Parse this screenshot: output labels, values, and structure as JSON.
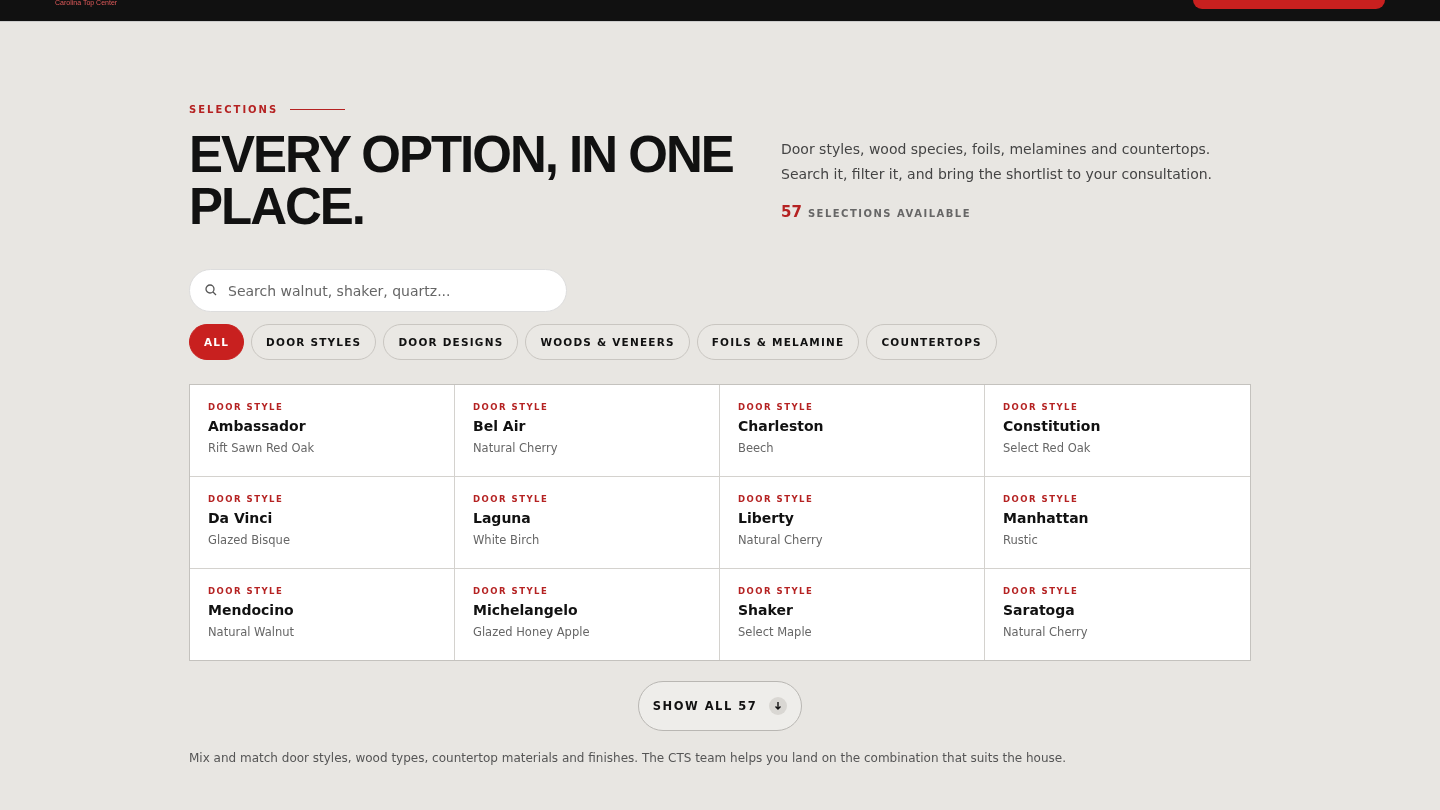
{
  "top_bar": {
    "logo_text": "Carolina Top Center"
  },
  "eyebrow": "SELECTIONS",
  "heading": "EVERY OPTION, IN ONE PLACE.",
  "intro": "Door styles, wood species, foils, melamines and countertops. Search it, filter it, and bring the shortlist to your consultation.",
  "count": {
    "number": "57",
    "label": "SELECTIONS AVAILABLE"
  },
  "search": {
    "placeholder": "Search walnut, shaker, quartz..."
  },
  "filters": [
    {
      "label": "ALL",
      "selected": true
    },
    {
      "label": "DOOR STYLES",
      "selected": false
    },
    {
      "label": "DOOR DESIGNS",
      "selected": false
    },
    {
      "label": "WOODS & VENEERS",
      "selected": false
    },
    {
      "label": "FOILS & MELAMINE",
      "selected": false
    },
    {
      "label": "COUNTERTOPS",
      "selected": false
    }
  ],
  "cards": [
    {
      "category": "DOOR STYLE",
      "name": "Ambassador",
      "finish": "Rift Sawn Red Oak"
    },
    {
      "category": "DOOR STYLE",
      "name": "Bel Air",
      "finish": "Natural Cherry"
    },
    {
      "category": "DOOR STYLE",
      "name": "Charleston",
      "finish": "Beech"
    },
    {
      "category": "DOOR STYLE",
      "name": "Constitution",
      "finish": "Select Red Oak"
    },
    {
      "category": "DOOR STYLE",
      "name": "Da Vinci",
      "finish": "Glazed Bisque"
    },
    {
      "category": "DOOR STYLE",
      "name": "Laguna",
      "finish": "White Birch"
    },
    {
      "category": "DOOR STYLE",
      "name": "Liberty",
      "finish": "Natural Cherry"
    },
    {
      "category": "DOOR STYLE",
      "name": "Manhattan",
      "finish": "Rustic"
    },
    {
      "category": "DOOR STYLE",
      "name": "Mendocino",
      "finish": "Natural Walnut"
    },
    {
      "category": "DOOR STYLE",
      "name": "Michelangelo",
      "finish": "Glazed Honey Apple"
    },
    {
      "category": "DOOR STYLE",
      "name": "Shaker",
      "finish": "Select Maple"
    },
    {
      "category": "DOOR STYLE",
      "name": "Saratoga",
      "finish": "Natural Cherry"
    }
  ],
  "show_all_button": "SHOW ALL 57",
  "footnote": "Mix and match door styles, wood types, countertop materials and finishes. The CTS team helps you land on the combination that suits the house."
}
